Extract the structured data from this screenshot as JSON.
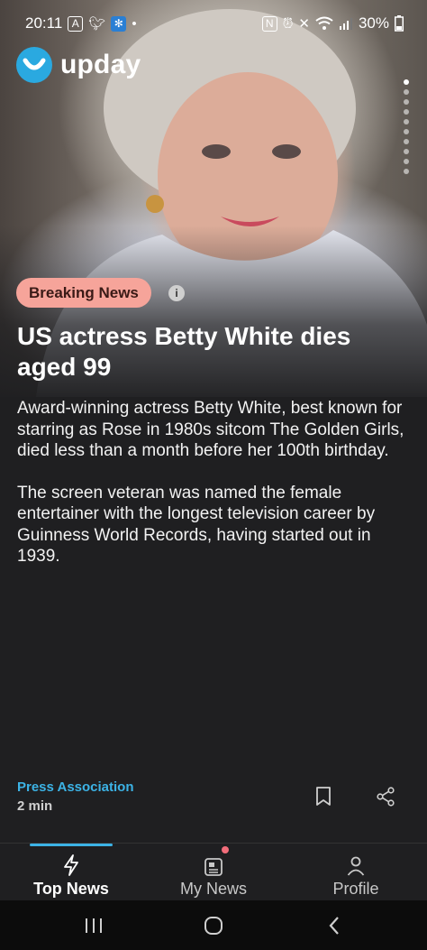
{
  "status_bar": {
    "time": "20:11",
    "battery": "30%",
    "left_icons": [
      "app-icon",
      "twitter-icon",
      "snowflake-icon"
    ],
    "right_icons": [
      "nfc-icon",
      "alarm-icon",
      "mute-icon",
      "wifi-icon",
      "signal-icon",
      "battery-icon"
    ]
  },
  "app": {
    "name": "upday"
  },
  "story": {
    "badge": "Breaking News",
    "headline": "US actress Betty White dies aged 99",
    "paragraphs": [
      "Award-winning actress Betty White, best known for starring as Rose in 1980s sitcom The Golden Girls, died less than a month before her 100th birthday.",
      "The screen veteran was named the female entertainer with the longest television career by Guinness World Records, having started out in 1939."
    ],
    "source": "Press Association",
    "read_time": "2 min"
  },
  "pager": {
    "count": 10,
    "active_index": 0
  },
  "tabs": [
    {
      "label": "Top News",
      "icon": "lightning-icon",
      "active": true
    },
    {
      "label": "My News",
      "icon": "news-icon",
      "active": false,
      "notification": true
    },
    {
      "label": "Profile",
      "icon": "person-icon",
      "active": false
    }
  ],
  "colors": {
    "accent": "#3cb3e6",
    "badge_bg": "#f6a49a",
    "background": "#1f1f21",
    "logo": "#2aa9e0",
    "notification": "#f26d7a"
  }
}
